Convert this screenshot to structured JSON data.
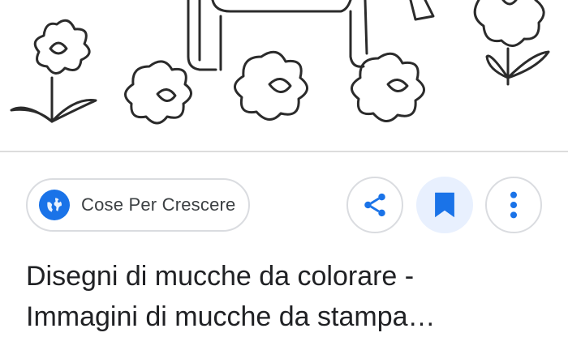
{
  "preview": {
    "image_name": "cow-coloring-page-preview"
  },
  "source": {
    "icon": "globe-icon",
    "name": "Cose Per Crescere"
  },
  "actions": {
    "share_icon": "share-icon",
    "save_icon": "bookmark-icon",
    "more_icon": "more-vert-icon"
  },
  "result": {
    "title_line1": "Disegni di mucche da colorare -",
    "title_line2": "Immagini di mucche da stampa…"
  },
  "colors": {
    "accent": "#1a73e8",
    "save_bg": "#e8f0fe",
    "border": "#dadce0",
    "text": "#202124"
  }
}
